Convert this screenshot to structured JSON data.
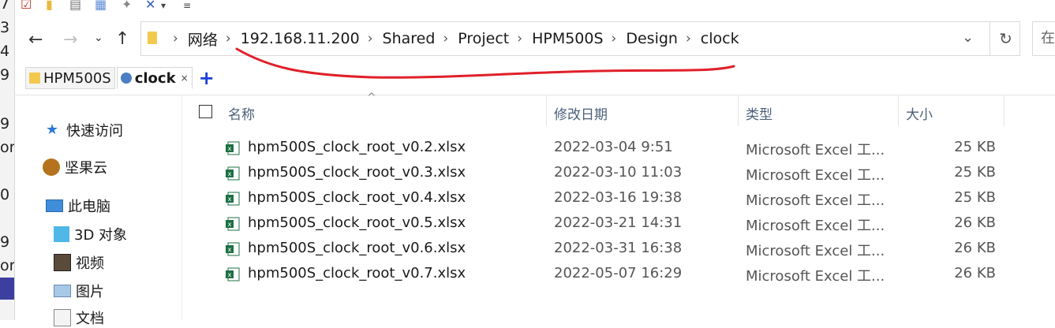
{
  "left_sliver": {
    "fragments": [
      "7",
      "3",
      "4",
      "9",
      "9",
      "or",
      "0",
      "9",
      "or"
    ]
  },
  "address": {
    "crumbs": [
      "网络",
      "192.168.11.200",
      "Shared",
      "Project",
      "HPM500S",
      "Design",
      "clock"
    ],
    "search_placeholder": "在"
  },
  "tabs": [
    {
      "label": "HPM500S",
      "active": false
    },
    {
      "label": "clock",
      "active": true
    }
  ],
  "tab_close": "×",
  "tab_add": "+",
  "sidebar": [
    {
      "label": "快速访问",
      "icon": "star-icon"
    },
    {
      "label": "坚果云",
      "icon": "nut-icon"
    },
    {
      "label": "此电脑",
      "icon": "computer-icon"
    },
    {
      "label": "3D 对象",
      "icon": "cube-icon"
    },
    {
      "label": "视频",
      "icon": "film-icon"
    },
    {
      "label": "图片",
      "icon": "picture-icon"
    },
    {
      "label": "文档",
      "icon": "document-icon"
    }
  ],
  "columns": {
    "name": "名称",
    "date": "修改日期",
    "type": "类型",
    "size": "大小"
  },
  "files": [
    {
      "name": "hpm500S_clock_root_v0.2.xlsx",
      "date": "2022-03-04 9:51",
      "type": "Microsoft Excel 工...",
      "size": "25 KB"
    },
    {
      "name": "hpm500S_clock_root_v0.3.xlsx",
      "date": "2022-03-10 11:03",
      "type": "Microsoft Excel 工...",
      "size": "25 KB"
    },
    {
      "name": "hpm500S_clock_root_v0.4.xlsx",
      "date": "2022-03-16 19:38",
      "type": "Microsoft Excel 工...",
      "size": "25 KB"
    },
    {
      "name": "hpm500S_clock_root_v0.5.xlsx",
      "date": "2022-03-21 14:31",
      "type": "Microsoft Excel 工...",
      "size": "26 KB"
    },
    {
      "name": "hpm500S_clock_root_v0.6.xlsx",
      "date": "2022-03-31 16:38",
      "type": "Microsoft Excel 工...",
      "size": "26 KB"
    },
    {
      "name": "hpm500S_clock_root_v0.7.xlsx",
      "date": "2022-05-07 16:29",
      "type": "Microsoft Excel 工...",
      "size": "26 KB"
    }
  ],
  "colors": {
    "annotation": "#e0202a",
    "excel": "#1d7044",
    "tab_add": "#1a3fd6",
    "folder": "#f2c94c"
  }
}
